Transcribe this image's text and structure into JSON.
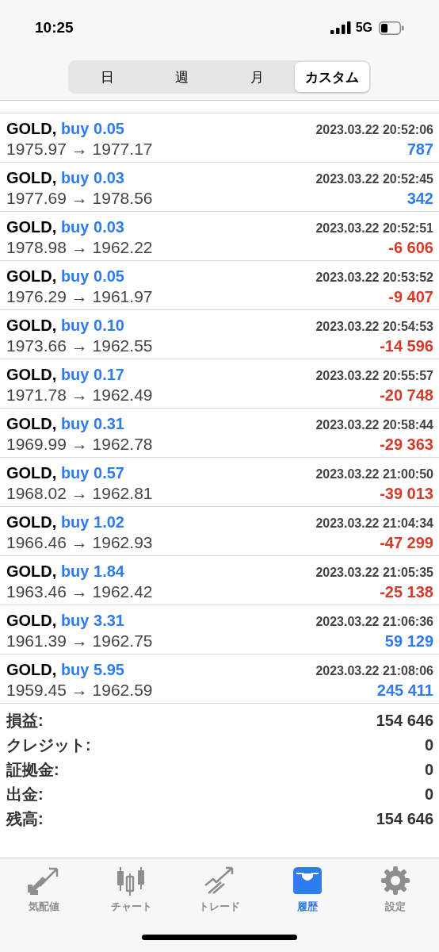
{
  "status_bar": {
    "time": "10:25",
    "network": "5G"
  },
  "segments": [
    {
      "label": "日",
      "selected": false
    },
    {
      "label": "週",
      "selected": false
    },
    {
      "label": "月",
      "selected": false
    },
    {
      "label": "カスタム",
      "selected": true
    }
  ],
  "trades": [
    {
      "symbol": "GOLD,",
      "order": "buy 0.05",
      "time": "2023.03.22 20:52:06",
      "prices": "1975.97 → 1977.17",
      "profit": "787",
      "loss": false
    },
    {
      "symbol": "GOLD,",
      "order": "buy 0.03",
      "time": "2023.03.22 20:52:45",
      "prices": "1977.69 → 1978.56",
      "profit": "342",
      "loss": false
    },
    {
      "symbol": "GOLD,",
      "order": "buy 0.03",
      "time": "2023.03.22 20:52:51",
      "prices": "1978.98 → 1962.22",
      "profit": "-6 606",
      "loss": true
    },
    {
      "symbol": "GOLD,",
      "order": "buy 0.05",
      "time": "2023.03.22 20:53:52",
      "prices": "1976.29 → 1961.97",
      "profit": "-9 407",
      "loss": true
    },
    {
      "symbol": "GOLD,",
      "order": "buy 0.10",
      "time": "2023.03.22 20:54:53",
      "prices": "1973.66 → 1962.55",
      "profit": "-14 596",
      "loss": true
    },
    {
      "symbol": "GOLD,",
      "order": "buy 0.17",
      "time": "2023.03.22 20:55:57",
      "prices": "1971.78 → 1962.49",
      "profit": "-20 748",
      "loss": true
    },
    {
      "symbol": "GOLD,",
      "order": "buy 0.31",
      "time": "2023.03.22 20:58:44",
      "prices": "1969.99 → 1962.78",
      "profit": "-29 363",
      "loss": true
    },
    {
      "symbol": "GOLD,",
      "order": "buy 0.57",
      "time": "2023.03.22 21:00:50",
      "prices": "1968.02 → 1962.81",
      "profit": "-39 013",
      "loss": true
    },
    {
      "symbol": "GOLD,",
      "order": "buy 1.02",
      "time": "2023.03.22 21:04:34",
      "prices": "1966.46 → 1962.93",
      "profit": "-47 299",
      "loss": true
    },
    {
      "symbol": "GOLD,",
      "order": "buy 1.84",
      "time": "2023.03.22 21:05:35",
      "prices": "1963.46 → 1962.42",
      "profit": "-25 138",
      "loss": true
    },
    {
      "symbol": "GOLD,",
      "order": "buy 3.31",
      "time": "2023.03.22 21:06:36",
      "prices": "1961.39 → 1962.75",
      "profit": "59 129",
      "loss": false
    },
    {
      "symbol": "GOLD,",
      "order": "buy 5.95",
      "time": "2023.03.22 21:08:06",
      "prices": "1959.45 → 1962.59",
      "profit": "245 411",
      "loss": false
    }
  ],
  "summary": [
    {
      "label": "損益:",
      "value": "154 646"
    },
    {
      "label": "クレジット:",
      "value": "0"
    },
    {
      "label": "証拠金:",
      "value": "0"
    },
    {
      "label": "出金:",
      "value": "0"
    },
    {
      "label": "残高:",
      "value": "154 646"
    }
  ],
  "tab_bar": [
    {
      "label": "気配値",
      "kind": "quotes",
      "selected": false
    },
    {
      "label": "チャート",
      "kind": "chart",
      "selected": false
    },
    {
      "label": "トレード",
      "kind": "trade",
      "selected": false
    },
    {
      "label": "履歴",
      "kind": "history",
      "selected": true
    },
    {
      "label": "設定",
      "kind": "settings",
      "selected": false
    }
  ]
}
